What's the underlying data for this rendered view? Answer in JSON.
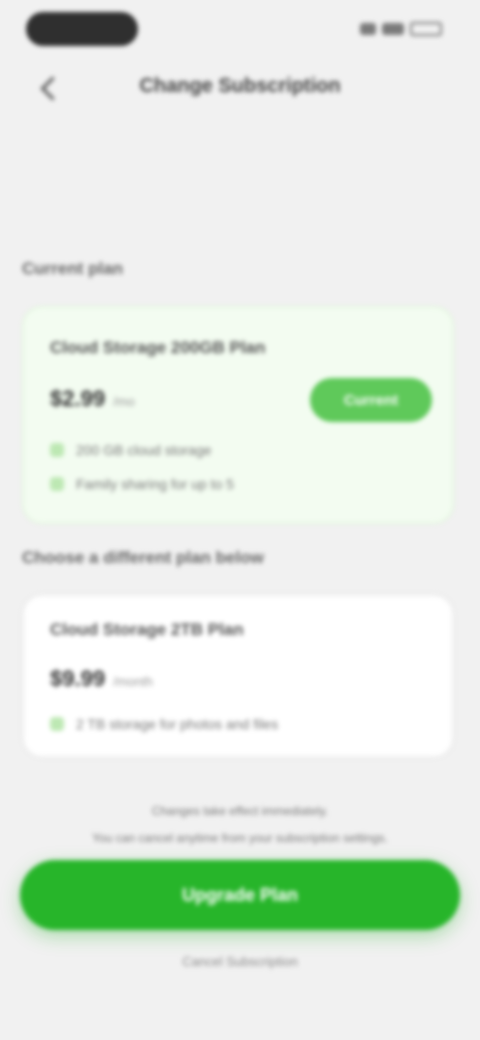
{
  "status_bar": {
    "time": "",
    "icons": [
      "signal-icon",
      "wifi-icon",
      "battery-icon"
    ]
  },
  "header": {
    "title": "Change Subscription",
    "back_icon": "chevron-left-icon"
  },
  "sections": {
    "current_label": "Current plan",
    "available_label": "Choose a different plan below"
  },
  "current_plan": {
    "name": "Cloud Storage 200GB Plan",
    "price": "$2.99",
    "period": "/mo",
    "status": "Current",
    "features": [
      "200 GB cloud storage",
      "Family sharing for up to 5"
    ]
  },
  "other_plan": {
    "name": "Cloud Storage 2TB Plan",
    "price": "$9.99",
    "period": "/month",
    "features": [
      "2 TB storage for photos and files"
    ]
  },
  "notice": {
    "line1": "Changes take effect immediately.",
    "line2": "You can cancel anytime from your subscription settings."
  },
  "buttons": {
    "primary": "Upgrade Plan",
    "secondary": "Cancel Subscription"
  },
  "colors": {
    "accent": "#27b52a",
    "badge": "#5fc95a",
    "current_card_bg": "#f3fcf1",
    "background": "#f1f1f1"
  }
}
